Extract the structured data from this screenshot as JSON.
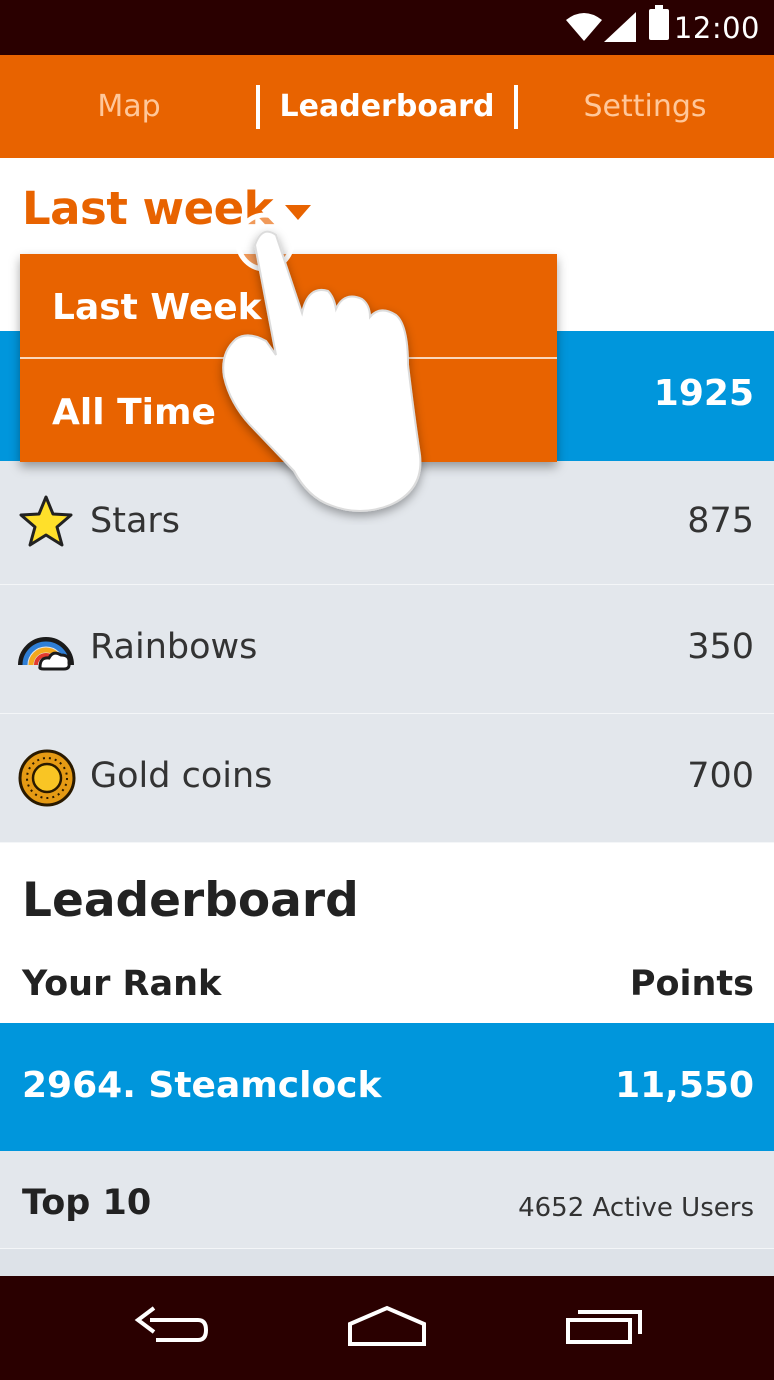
{
  "status_bar": {
    "time": "12:00"
  },
  "tabs": [
    {
      "label": "Map",
      "active": false
    },
    {
      "label": "Leaderboard",
      "active": true
    },
    {
      "label": "Settings",
      "active": false
    }
  ],
  "period_select": {
    "value": "Last week"
  },
  "dropdown": {
    "options": [
      "Last Week",
      "All Time"
    ]
  },
  "summary": {
    "total": "1925",
    "categories": [
      {
        "label": "Stars",
        "value": "875",
        "icon": "star-icon"
      },
      {
        "label": "Rainbows",
        "value": "350",
        "icon": "rainbow-icon"
      },
      {
        "label": "Gold coins",
        "value": "700",
        "icon": "gold-coin-icon"
      }
    ]
  },
  "leaderboard": {
    "title": "Leaderboard",
    "rank_header": "Your Rank",
    "points_header": "Points",
    "me": {
      "name": "2964. Steamclock",
      "points": "11,550"
    },
    "top10_label": "Top 10",
    "active_users": "4652 Active Users"
  },
  "colors": {
    "accent": "#e86300",
    "highlight": "#0096dc",
    "row_bg": "#e3e7ec",
    "system_bar": "#2a0000"
  }
}
